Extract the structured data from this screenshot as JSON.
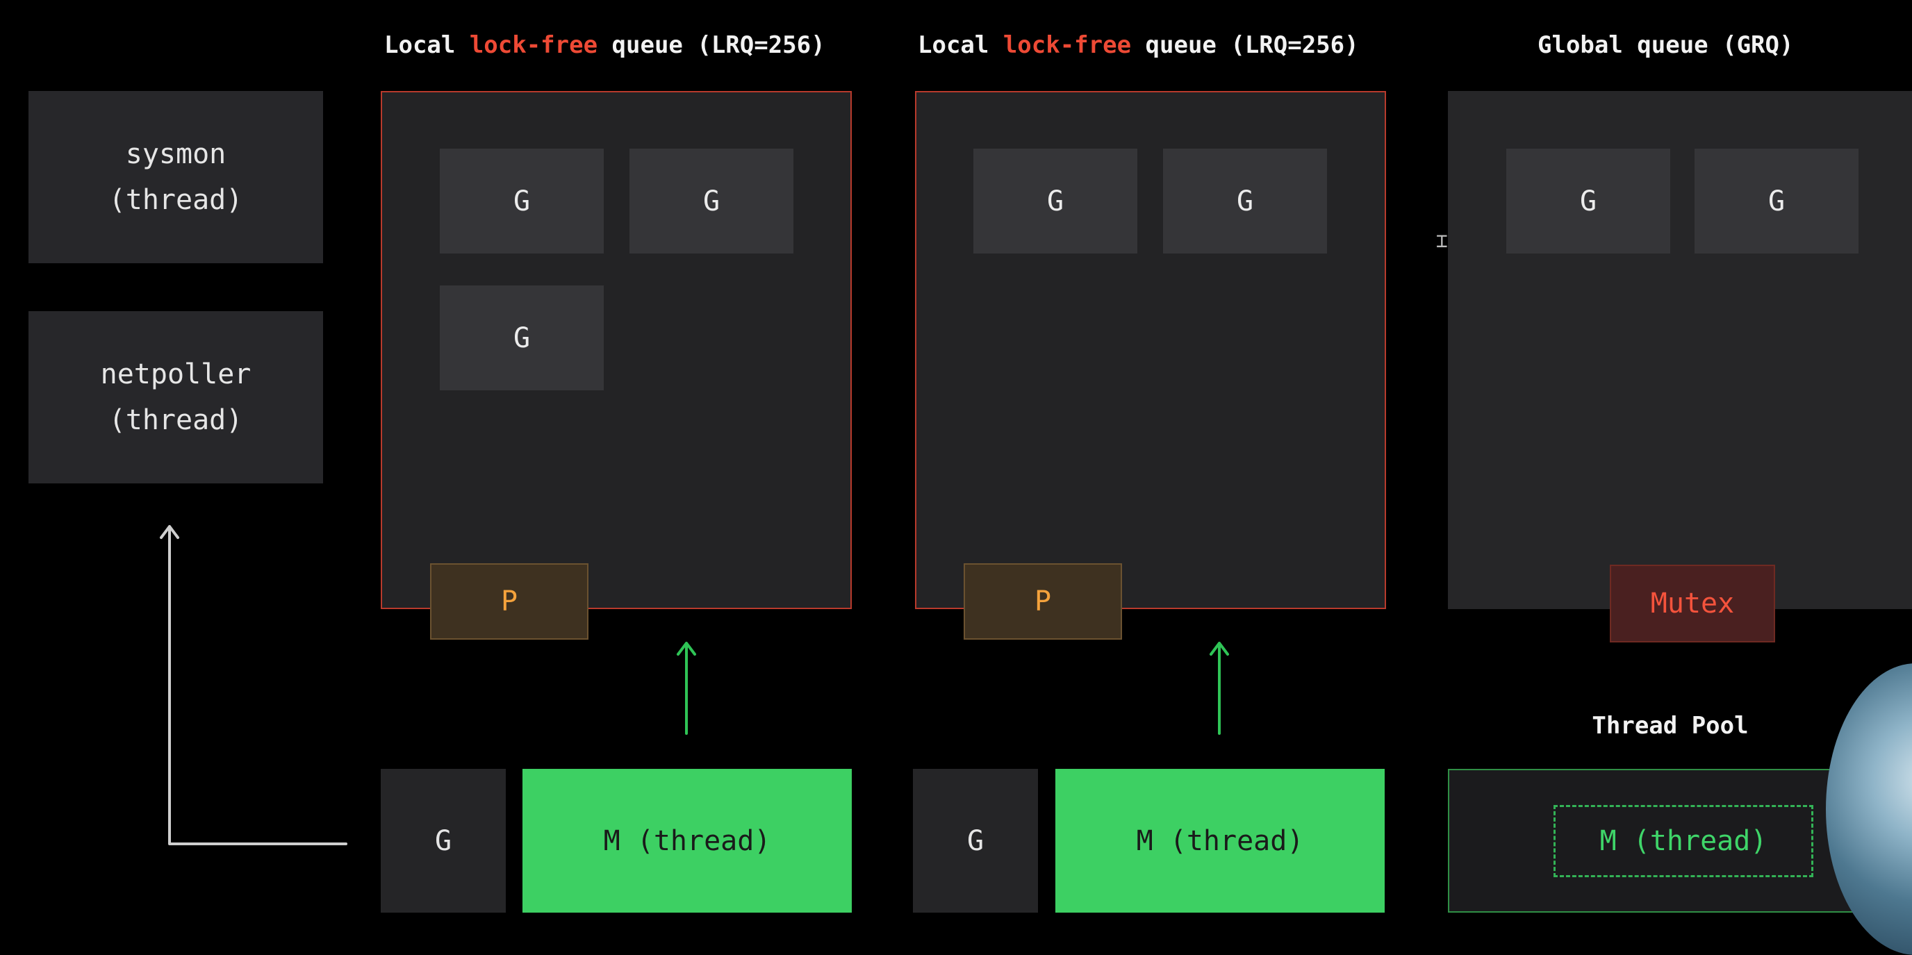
{
  "columns": [
    {
      "header_prefix": "Local ",
      "header_highlight": "lock-free",
      "header_suffix": " queue (LRQ=256)",
      "goroutines": [
        "G",
        "G",
        "G"
      ],
      "processor": "P",
      "running_goroutine": "G",
      "machine": "M (thread)"
    },
    {
      "header_prefix": "Local ",
      "header_highlight": "lock-free",
      "header_suffix": " queue (LRQ=256)",
      "goroutines": [
        "G",
        "G"
      ],
      "processor": "P",
      "running_goroutine": "G",
      "machine": "M (thread)"
    }
  ],
  "global": {
    "header": "Global queue (GRQ)",
    "goroutines": [
      "G",
      "G"
    ],
    "lock": "Mutex"
  },
  "thread_pool": {
    "title": "Thread Pool",
    "machine": "M (thread)"
  },
  "side_threads": {
    "sysmon": "sysmon\n(thread)",
    "netpoller": "netpoller\n(thread)"
  },
  "colors": {
    "background": "#000000",
    "highlight": "#ee4a35",
    "processor": "#f4a23c",
    "machine": "#3dd063",
    "mutex": "#f4533c",
    "arrow_green": "#2fc456",
    "arrow_gray": "#cfcfcf"
  }
}
